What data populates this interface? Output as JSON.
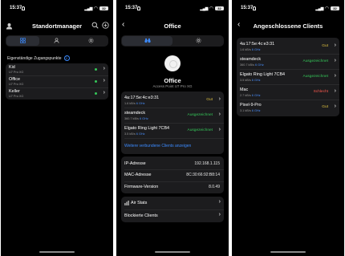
{
  "status_bar": {
    "time": "15:37",
    "battery": "32"
  },
  "screen1": {
    "title": "Standortmanager",
    "section_label": "Eigenständige Zugangspunkte",
    "access_points": [
      {
        "name": "Kid",
        "model": "U7 Pro XG"
      },
      {
        "name": "Office",
        "model": "U7 Pro XG"
      },
      {
        "name": "Keller",
        "model": "U7 Pro XG"
      }
    ]
  },
  "screen2": {
    "title": "Office",
    "device_name": "Office",
    "device_model": "Access Point U7 Pro XG",
    "clients": [
      {
        "name": "4a:17:5e:4c:e3:31",
        "rate": "1.6 kB/s",
        "band": "6 GHz",
        "quality": "Gut",
        "level": "good"
      },
      {
        "name": "steamdeck",
        "rate": "360.7 kB/s",
        "band": "6 GHz",
        "quality": "Ausgezeichnet",
        "level": "exc"
      },
      {
        "name": "Elgato Ring Light 7CB4",
        "rate": "3.5 kB/s",
        "band": "6 GHz",
        "quality": "Ausgezeichnet",
        "level": "exc"
      }
    ],
    "more_clients_link": "Weitere verbundene Clients anzeigen",
    "details": [
      {
        "label": "IP-Adresse",
        "value": "192.168.1.115"
      },
      {
        "label": "MAC-Adresse",
        "value": "8C:30:66:92:B8:14"
      },
      {
        "label": "Firmware-Version",
        "value": "8.0.49"
      }
    ],
    "actions": [
      {
        "label": "Air Stats"
      },
      {
        "label": "Blockierte Clients"
      }
    ]
  },
  "screen3": {
    "title": "Angeschlossene Clients",
    "clients": [
      {
        "name": "4a:17:5e:4c:e3:31",
        "rate": "1.6 kB/s",
        "band": "6 GHz",
        "quality": "Gut",
        "level": "good"
      },
      {
        "name": "steamdeck",
        "rate": "360.7 kB/s",
        "band": "6 GHz",
        "quality": "Ausgezeichnet",
        "level": "exc"
      },
      {
        "name": "Elgato Ring Light 7CB4",
        "rate": "3.5 kB/s",
        "band": "6 GHz",
        "quality": "Ausgezeichnet",
        "level": "exc"
      },
      {
        "name": "Mac",
        "rate": "2.7 kB/s",
        "band": "6 GHz",
        "quality": "Schlecht",
        "level": "bad"
      },
      {
        "name": "Pixel-9-Pro",
        "rate": "3.1 kB/s",
        "band": "6 GHz",
        "quality": "Gut",
        "level": "good"
      }
    ]
  },
  "colors": {
    "accent": "#3c8bff",
    "good": "#e0c341",
    "excellent": "#35c759",
    "bad": "#ff5a4f",
    "card": "#1c1c1e"
  }
}
